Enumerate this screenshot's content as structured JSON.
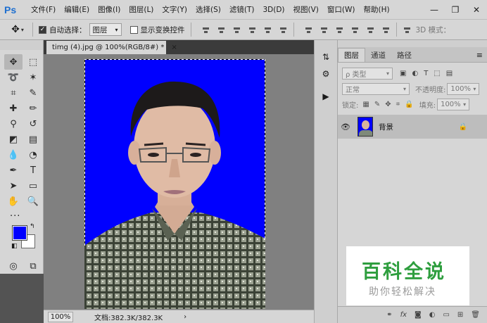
{
  "app": {
    "logo": "Ps"
  },
  "menu": [
    "文件(F)",
    "编辑(E)",
    "图像(I)",
    "图层(L)",
    "文字(Y)",
    "选择(S)",
    "滤镜(T)",
    "3D(D)",
    "视图(V)",
    "窗口(W)",
    "帮助(H)"
  ],
  "window_controls": {
    "minimize": "—",
    "restore": "❐",
    "close": "✕"
  },
  "options": {
    "auto_select_label": "自动选择：",
    "auto_select_checked": true,
    "auto_select_value": "图层",
    "show_transform_label": "显示变换控件",
    "show_transform_checked": false,
    "mode_3d_label": "3D 模式："
  },
  "document": {
    "tab_title": "timg (4).jpg @ 100%(RGB/8#) *",
    "close_glyph": "×",
    "zoom": "100%",
    "doc_size": "文档:382.3K/382.3K",
    "status_arrow": "›"
  },
  "colors": {
    "foreground": "#0000ff",
    "background": "#ffffff",
    "accent": "#1e6fd0"
  },
  "layers_panel": {
    "tabs": [
      "图层",
      "通道",
      "路径"
    ],
    "active_tab": 0,
    "filter_placeholder": "ρ 类型",
    "blend_mode": "正常",
    "opacity_label": "不透明度:",
    "opacity_value": "100%",
    "lock_label": "锁定:",
    "fill_label": "填充:",
    "fill_value": "100%",
    "layers": [
      {
        "name": "背景",
        "visible": true,
        "locked": true
      }
    ],
    "footer_icons": [
      "link-icon",
      "fx-icon",
      "mask-icon",
      "adjustment-icon",
      "folder-icon",
      "new-layer-icon",
      "trash-icon"
    ]
  },
  "watermark": {
    "title": "百科全说",
    "subtitle": "助你轻松解决"
  }
}
